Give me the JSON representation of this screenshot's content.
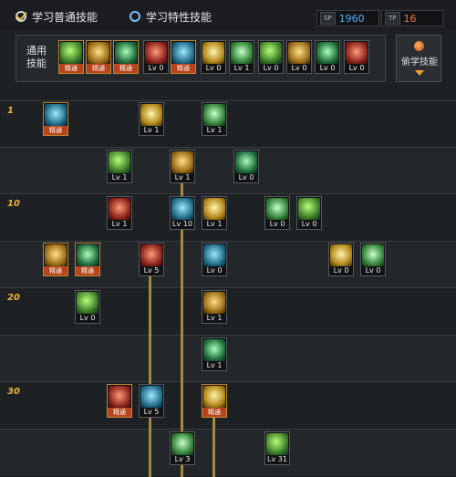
{
  "header": {
    "tab_normal": "学习普通技能",
    "tab_special": "学习特性技能",
    "sp_normal_tag": "SP",
    "sp_normal_value": "1960",
    "sp_special_tag": "TP",
    "sp_special_value": "16"
  },
  "common_skills": {
    "label": "通用技能",
    "steal_label": "偷学技能"
  },
  "levels": [
    "1",
    "10",
    "20",
    "30"
  ],
  "texts": {
    "master": "精通"
  },
  "colors": {
    "accent": "#e8b23a",
    "sp": "#4fb3ff",
    "tp": "#ff7a3a",
    "master_bg": "#b8441c"
  },
  "slots": [
    {
      "id": "c1",
      "label": "精通",
      "type": "master",
      "icon": "reading-icon"
    },
    {
      "id": "c2",
      "label": "精通",
      "type": "master",
      "icon": "rage-icon"
    },
    {
      "id": "c3",
      "label": "精通",
      "type": "master",
      "icon": "backstep-icon"
    },
    {
      "id": "c4",
      "label": "Lv 0",
      "type": "lv",
      "icon": "wing-icon"
    },
    {
      "id": "c5",
      "label": "精通",
      "type": "master",
      "icon": "target-icon"
    },
    {
      "id": "c6",
      "label": "Lv 0",
      "type": "lv",
      "icon": "cross-icon"
    },
    {
      "id": "c7",
      "label": "Lv 1",
      "type": "lv",
      "icon": "runner-icon"
    },
    {
      "id": "c8",
      "label": "Lv 0",
      "type": "lv",
      "icon": "mountain-icon"
    },
    {
      "id": "c9",
      "label": "Lv 0",
      "type": "lv",
      "icon": "ring-icon"
    },
    {
      "id": "c10",
      "label": "Lv 0",
      "type": "lv",
      "icon": "fighter-icon"
    },
    {
      "id": "c11",
      "label": "Lv 0",
      "type": "lv",
      "icon": "leaf-icon"
    },
    {
      "id": "t1",
      "label": "精通",
      "type": "master",
      "icon": "cactus-icon"
    },
    {
      "id": "t2",
      "label": "Lv 1",
      "type": "lv",
      "icon": "uppercut-icon"
    },
    {
      "id": "t3",
      "label": "Lv 1",
      "type": "lv",
      "icon": "kick-icon"
    },
    {
      "id": "t4",
      "label": "Lv 1",
      "type": "lv",
      "icon": "burst-icon"
    },
    {
      "id": "t5",
      "label": "Lv 1",
      "type": "lv",
      "icon": "slash-icon"
    },
    {
      "id": "t6",
      "label": "Lv 0",
      "type": "lv",
      "icon": "gun-icon"
    },
    {
      "id": "t7",
      "label": "Lv 1",
      "type": "lv",
      "icon": "blade-icon"
    },
    {
      "id": "t8",
      "label": "Lv 10",
      "type": "lv",
      "icon": "impact-icon"
    },
    {
      "id": "t9",
      "label": "Lv 1",
      "type": "lv",
      "icon": "thrust-icon"
    },
    {
      "id": "t10",
      "label": "Lv 0",
      "type": "lv",
      "icon": "box-icon"
    },
    {
      "id": "t11",
      "label": "Lv 0",
      "type": "lv",
      "icon": "fountain-icon"
    },
    {
      "id": "t12",
      "label": "精通",
      "type": "master",
      "icon": "rifle-icon"
    },
    {
      "id": "t13",
      "label": "精通",
      "type": "master",
      "icon": "spear-icon"
    },
    {
      "id": "t14",
      "label": "Lv 5",
      "type": "lv",
      "icon": "shot-icon"
    },
    {
      "id": "t15",
      "label": "Lv 0",
      "type": "lv",
      "icon": "shield-icon"
    },
    {
      "id": "t16",
      "label": "Lv 0",
      "type": "lv",
      "icon": "axe-icon"
    },
    {
      "id": "t17",
      "label": "Lv 0",
      "type": "lv",
      "icon": "grenade-icon"
    },
    {
      "id": "t18",
      "label": "Lv 0",
      "type": "lv",
      "icon": "fist-icon"
    },
    {
      "id": "t19",
      "label": "Lv 1",
      "type": "lv",
      "icon": "eye-icon"
    },
    {
      "id": "t20",
      "label": "Lv 1",
      "type": "lv",
      "icon": "arrow-icon"
    },
    {
      "id": "t21",
      "label": "精通",
      "type": "master",
      "icon": "cannon-icon"
    },
    {
      "id": "t22",
      "label": "Lv 5",
      "type": "lv",
      "icon": "beam-icon"
    },
    {
      "id": "t23",
      "label": "精通",
      "type": "master",
      "icon": "orb-icon"
    },
    {
      "id": "t24",
      "label": "Lv 3",
      "type": "lv",
      "icon": "sword-icon"
    },
    {
      "id": "t25",
      "label": "Lv 31",
      "type": "lv",
      "icon": "vortex-icon"
    }
  ]
}
